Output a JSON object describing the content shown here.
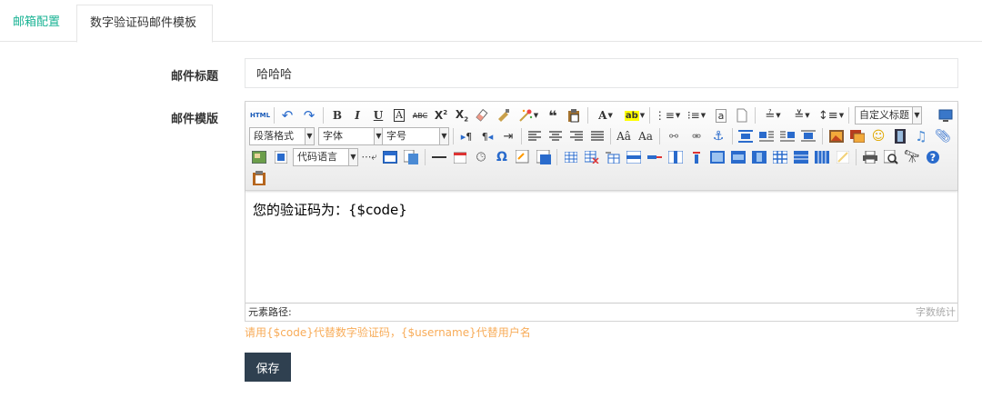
{
  "tabs": [
    {
      "label": "邮箱配置"
    },
    {
      "label": "数字验证码邮件模板"
    }
  ],
  "form": {
    "title_label": "邮件标题",
    "title_value": "哈哈哈",
    "template_label": "邮件模版"
  },
  "editor": {
    "html_btn": "HTML",
    "custom_title": "自定义标题",
    "paragraph": "段落格式",
    "font_family": "字体",
    "font_size": "字号",
    "code_lang": "代码语言",
    "content": "您的验证码为：{$code}",
    "element_path": "元素路径:",
    "word_count": "字数统计"
  },
  "hint": "请用{$code}代替数字验证码，{$username}代替用户名",
  "save_label": "保存",
  "colors": {
    "tab_active": "#1ab394",
    "hint": "#f8ac59",
    "button": "#2f4050"
  }
}
